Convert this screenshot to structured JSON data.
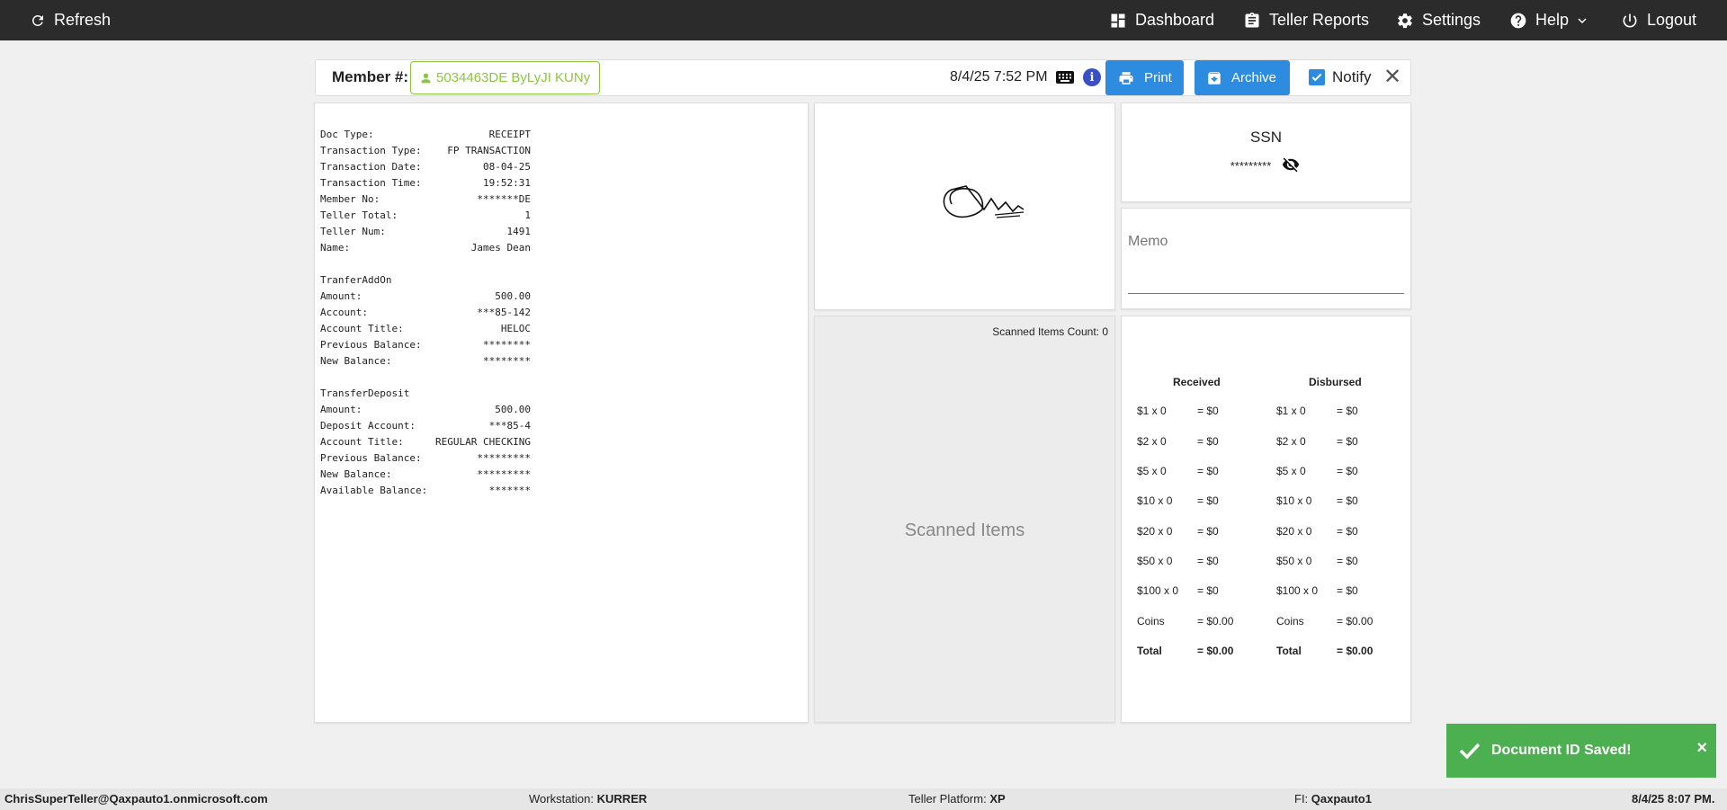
{
  "topbar": {
    "refresh": "Refresh",
    "dashboard": "Dashboard",
    "teller_reports": "Teller Reports",
    "settings": "Settings",
    "help": "Help",
    "logout": "Logout"
  },
  "member_bar": {
    "label": "Member #:",
    "member_value": "5034463DE ByLyJI KUNy",
    "datetime": "8/4/25 7:52 PM",
    "print": "Print",
    "archive": "Archive",
    "notify": "Notify",
    "notify_checked": true
  },
  "receipt": {
    "lines": [
      [
        "Doc Type:",
        "RECEIPT"
      ],
      [
        "Transaction Type:",
        "FP TRANSACTION"
      ],
      [
        "Transaction Date:",
        "08-04-25"
      ],
      [
        "Transaction Time:",
        "19:52:31"
      ],
      [
        "Member No:",
        "*******DE"
      ],
      [
        "Teller Total:",
        "1"
      ],
      [
        "Teller Num:",
        "1491"
      ],
      [
        "Name:",
        "James Dean"
      ],
      [
        "",
        ""
      ],
      [
        "TranferAddOn",
        ""
      ],
      [
        "Amount:",
        "500.00"
      ],
      [
        "Account:",
        "***85-142"
      ],
      [
        "Account Title:",
        "HELOC"
      ],
      [
        "Previous Balance:",
        "********"
      ],
      [
        "New Balance:",
        "********"
      ],
      [
        "",
        ""
      ],
      [
        "TransferDeposit",
        ""
      ],
      [
        "Amount:",
        "500.00"
      ],
      [
        "Deposit Account:",
        "***85-4"
      ],
      [
        "Account Title:",
        "REGULAR CHECKING"
      ],
      [
        "Previous Balance:",
        "*********"
      ],
      [
        "New Balance:",
        "*********"
      ],
      [
        "Available Balance:",
        "*******"
      ]
    ]
  },
  "scanned": {
    "count_label": "Scanned Items Count: 0",
    "title": "Scanned Items"
  },
  "ssn": {
    "title": "SSN",
    "value": "*********"
  },
  "memo": {
    "label": "Memo"
  },
  "cash": {
    "received_title": "Received",
    "disbursed_title": "Disbursed",
    "received": [
      [
        "$1 x 0",
        "= $0"
      ],
      [
        "$2 x 0",
        "= $0"
      ],
      [
        "$5 x 0",
        "= $0"
      ],
      [
        "$10 x 0",
        "= $0"
      ],
      [
        "$20 x 0",
        "= $0"
      ],
      [
        "$50 x 0",
        "= $0"
      ],
      [
        "$100 x 0",
        "= $0"
      ],
      [
        "Coins",
        "= $0.00"
      ],
      [
        "Total",
        "= $0.00"
      ]
    ],
    "disbursed": [
      [
        "$1 x 0",
        "= $0"
      ],
      [
        "$2 x 0",
        "= $0"
      ],
      [
        "$5 x 0",
        "= $0"
      ],
      [
        "$10 x 0",
        "= $0"
      ],
      [
        "$20 x 0",
        "= $0"
      ],
      [
        "$50 x 0",
        "= $0"
      ],
      [
        "$100 x 0",
        "= $0"
      ],
      [
        "Coins",
        "= $0.00"
      ],
      [
        "Total",
        "= $0.00"
      ]
    ]
  },
  "toast": {
    "message": "Document ID Saved!"
  },
  "footer": {
    "user": "ChrisSuperTeller@Qaxpauto1.onmicrosoft.com",
    "workstation_label": "Workstation:",
    "workstation": "KURRER",
    "platform_label": "Teller Platform:",
    "platform": "XP",
    "fi_label": "FI:",
    "fi": "Qaxpauto1",
    "datetime": "8/4/25 8:07 PM."
  },
  "colors": {
    "topbar": "#2b2b2b",
    "accent_blue": "#2d8be0",
    "member_green": "#8cc63f",
    "toast_green": "#4caf50"
  }
}
